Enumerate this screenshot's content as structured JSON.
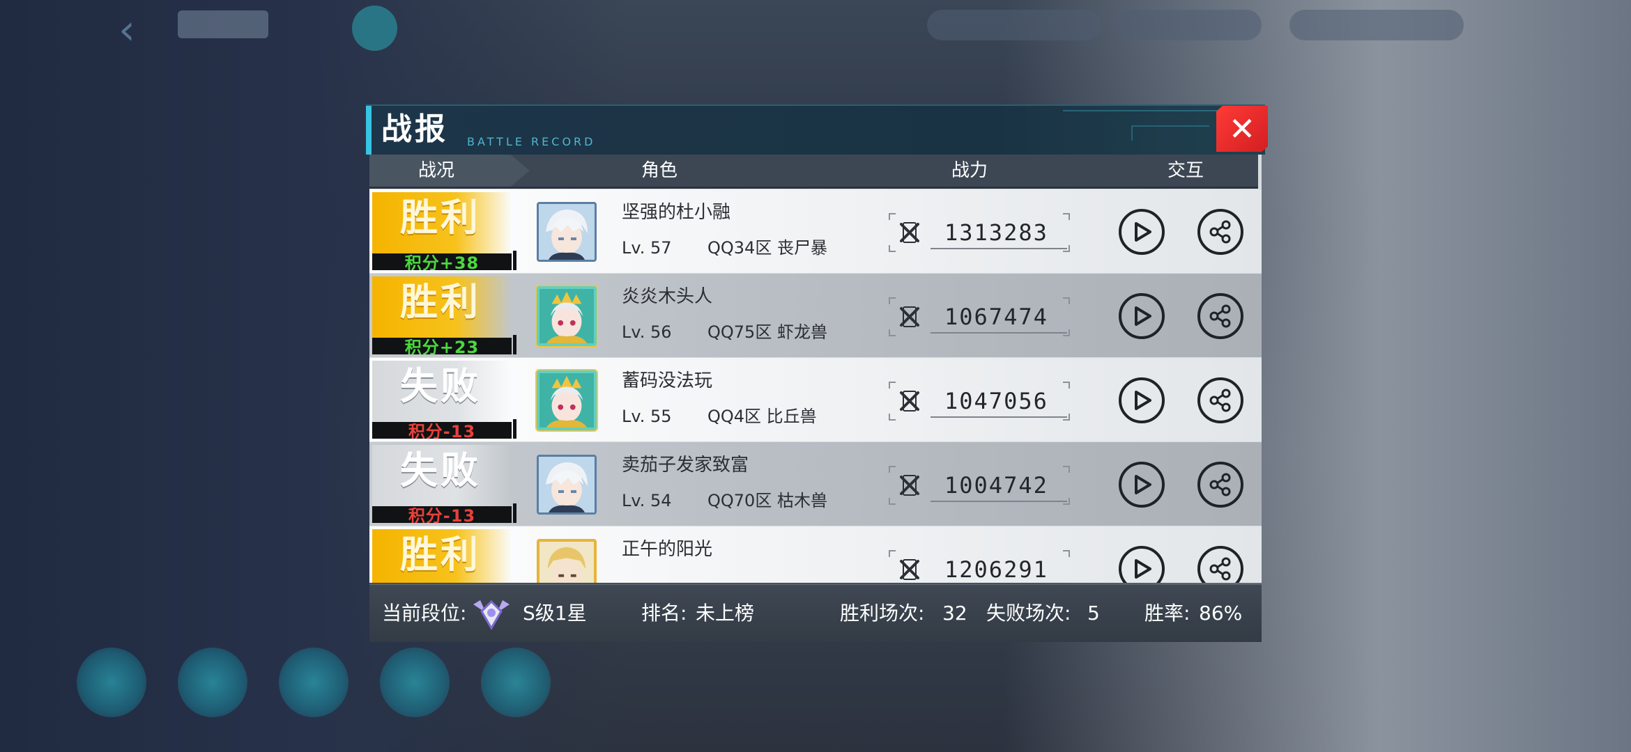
{
  "dialog": {
    "title": "战报",
    "subtitle": "BATTLE RECORD",
    "close_label": "✕"
  },
  "columns": {
    "status": "战况",
    "role": "角色",
    "power": "战力",
    "interact": "交互"
  },
  "records": [
    {
      "result": "胜利",
      "outcome": "win",
      "score": "积分+38",
      "name": "坚强的杜小融",
      "level": "Lv. 57",
      "server": "QQ34区 丧尸暴",
      "power": "1313283",
      "avatar": "white-hair-boy"
    },
    {
      "result": "胜利",
      "outcome": "win",
      "score": "积分+23",
      "name": "炎炎木头人",
      "level": "Lv. 56",
      "server": "QQ75区 虾龙兽",
      "power": "1067474",
      "avatar": "crowned-girl"
    },
    {
      "result": "失败",
      "outcome": "lose",
      "score": "积分-13",
      "name": "蓄码没法玩",
      "level": "Lv. 55",
      "server": "QQ4区 比丘兽",
      "power": "1047056",
      "avatar": "crowned-girl"
    },
    {
      "result": "失败",
      "outcome": "lose",
      "score": "积分-13",
      "name": "卖茄子发家致富",
      "level": "Lv. 54",
      "server": "QQ70区 枯木兽",
      "power": "1004742",
      "avatar": "white-hair-boy"
    },
    {
      "result": "胜利",
      "outcome": "win",
      "score": "",
      "name": "正午的阳光",
      "level": "",
      "server": "",
      "power": "1206291",
      "avatar": "golden-hair-boy"
    }
  ],
  "footer": {
    "rank_label": "当前段位:",
    "rank_value": "S级1星",
    "ranking_label": "排名:",
    "ranking_value": "未上榜",
    "wins_label": "胜利场次:",
    "wins_value": "32",
    "losses_label": "失败场次:",
    "losses_value": "5",
    "winrate_label": "胜率:",
    "winrate_value": "86%"
  },
  "colors": {
    "win_gold": "#f5b400",
    "score_positive": "#4ad83c",
    "score_negative": "#e8413a",
    "header_accent": "#37c4e4",
    "close_red": "#e22a2b"
  }
}
